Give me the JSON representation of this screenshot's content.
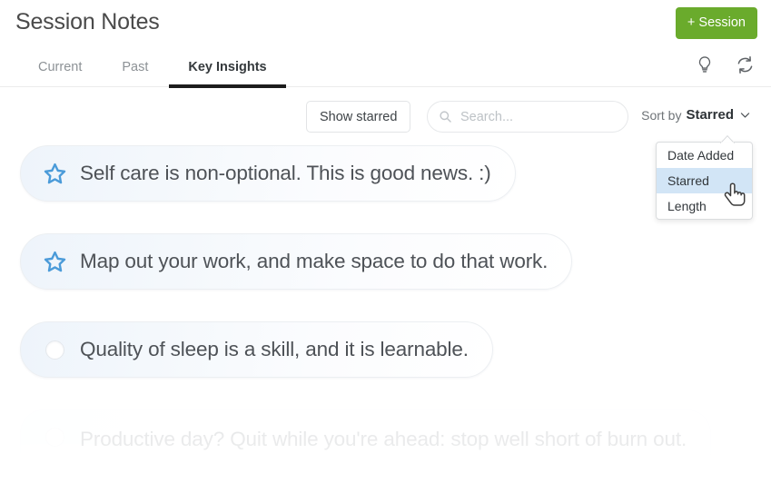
{
  "header": {
    "title": "Session Notes",
    "new_session_label": "+ Session",
    "icons": [
      {
        "name": "lightbulb-icon"
      },
      {
        "name": "refresh-icon"
      }
    ]
  },
  "tabs": [
    {
      "label": "Current",
      "active": false
    },
    {
      "label": "Past",
      "active": false
    },
    {
      "label": "Key Insights",
      "active": true
    }
  ],
  "toolbar": {
    "show_starred_label": "Show starred",
    "search": {
      "value": "",
      "placeholder": "Search...",
      "icon": "search-icon"
    },
    "sort": {
      "label": "Sort by",
      "value": "Starred",
      "chevron": "chevron-down-icon",
      "open": true,
      "options": [
        {
          "label": "Date Added",
          "selected": false
        },
        {
          "label": "Starred",
          "selected": true
        },
        {
          "label": "Length",
          "selected": false
        }
      ]
    }
  },
  "notes": [
    {
      "text": "Self care is non-optional. This is good news. :)",
      "starred": true,
      "icon": "star-icon",
      "faded": false
    },
    {
      "text": "Map out your work, and make space to do that work.",
      "starred": true,
      "icon": "star-icon",
      "faded": false
    },
    {
      "text": "Quality of sleep is a skill, and it is learnable.",
      "starred": false,
      "icon": "circle-icon",
      "faded": false
    },
    {
      "text": "Productive day? Quit while you're ahead: stop well short of burn out.",
      "starred": false,
      "icon": "circle-icon",
      "faded": true
    }
  ],
  "cursor": {
    "type": "pointer-hand-cursor"
  },
  "colors": {
    "accent_green": "#6aab2c",
    "star_blue": "#4b9bd9",
    "dropdown_highlight": "#d2e5f6",
    "active_tab_underline": "#1c1c1c",
    "text_primary": "#4e5257",
    "text_muted": "#8d9296"
  }
}
